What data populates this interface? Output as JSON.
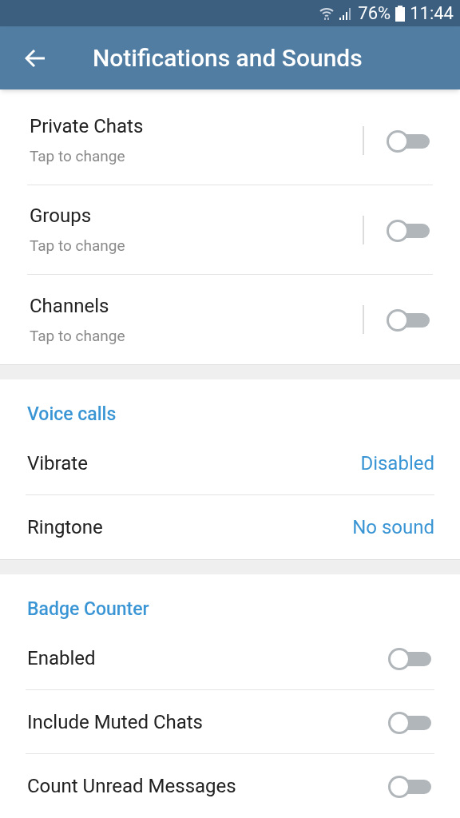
{
  "status_bar": {
    "battery": "76%",
    "time": "11:44"
  },
  "header": {
    "title": "Notifications and Sounds"
  },
  "chat_settings": [
    {
      "title": "Private Chats",
      "subtitle": "Tap to change",
      "on": false
    },
    {
      "title": "Groups",
      "subtitle": "Tap to change",
      "on": false
    },
    {
      "title": "Channels",
      "subtitle": "Tap to change",
      "on": false
    }
  ],
  "sections": [
    {
      "title": "Voice calls",
      "rows": [
        {
          "kind": "value",
          "label": "Vibrate",
          "value": "Disabled"
        },
        {
          "kind": "value",
          "label": "Ringtone",
          "value": "No sound"
        }
      ]
    },
    {
      "title": "Badge Counter",
      "rows": [
        {
          "kind": "toggle",
          "label": "Enabled",
          "on": false
        },
        {
          "kind": "toggle",
          "label": "Include Muted Chats",
          "on": false
        },
        {
          "kind": "toggle",
          "label": "Count Unread Messages",
          "on": false
        }
      ]
    }
  ]
}
